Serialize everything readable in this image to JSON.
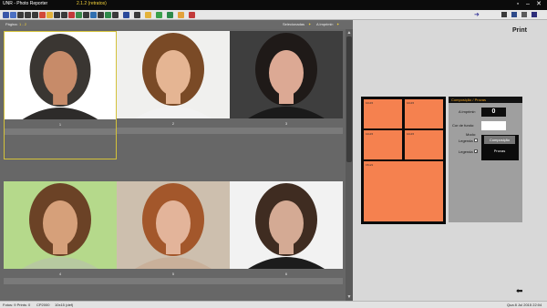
{
  "window": {
    "title": "UNR - Photo Reporter",
    "version": "2.1.2 (retratos)"
  },
  "toolbar": {
    "icons": [
      "app-icon",
      "open-icon",
      "back-icon",
      "forward-icon",
      "undo-icon",
      "select-icon",
      "pen-icon",
      "edit-icon",
      "wand-icon",
      "mail-icon",
      "palette-icon",
      "text-icon",
      "list-icon",
      "crop-icon",
      "grid-icon",
      "zoom-icon",
      "info-icon",
      "filter-icon",
      "star-icon",
      "add-icon",
      "export-icon",
      "warning-icon",
      "trash-icon"
    ]
  },
  "subbar": {
    "pages_label": "Página:",
    "pages_value": "1 - 2",
    "selected_label": "Selecionadas",
    "print_label": "A imprimir:"
  },
  "photos": [
    {
      "label": "1",
      "selected": true,
      "bg": "#ffffff",
      "skin": "#c78b69",
      "hair": "#3a3632",
      "top": "#2d2b2a"
    },
    {
      "label": "2",
      "selected": false,
      "bg": "#f0f0ee",
      "skin": "#e5b593",
      "hair": "#7a4a26",
      "top": "#f2f2f2"
    },
    {
      "label": "3",
      "selected": false,
      "bg": "#3e3e3e",
      "skin": "#dca994",
      "hair": "#1f1a18",
      "top": "#1a1a1a"
    },
    {
      "label": "4",
      "selected": false,
      "bg": "#b5d98b",
      "skin": "#d6a07a",
      "hair": "#6b4226",
      "top": "#b7c9a0"
    },
    {
      "label": "5",
      "selected": false,
      "bg": "#cdbfae",
      "skin": "#e3b49a",
      "hair": "#a3572b",
      "top": "#c9b09a"
    },
    {
      "label": "6",
      "selected": false,
      "bg": "#f2f2f2",
      "skin": "#d4aa94",
      "hair": "#3f2c21",
      "top": "#1c1c1c"
    }
  ],
  "print_panel": {
    "title": "Print",
    "slots": [
      "10x15",
      "10x15",
      "10x15",
      "10x15",
      "15x21"
    ],
    "header": "Composição / Provas",
    "to_print_label": "A imprimir:",
    "to_print_value": "0",
    "bg_color_label": "Cor de fundo:",
    "mode_label": "Modo:",
    "caption1_label": "Legenda",
    "caption2_label": "Legenda",
    "btn_composition": "Composição",
    "btn_proofs": "Provas"
  },
  "status": {
    "left": "Fotos: 9 Prints: 0",
    "mid1": "CP2000",
    "mid2": "10x15 (def)",
    "right": "Qua 8 Jul 2015 22:04"
  }
}
